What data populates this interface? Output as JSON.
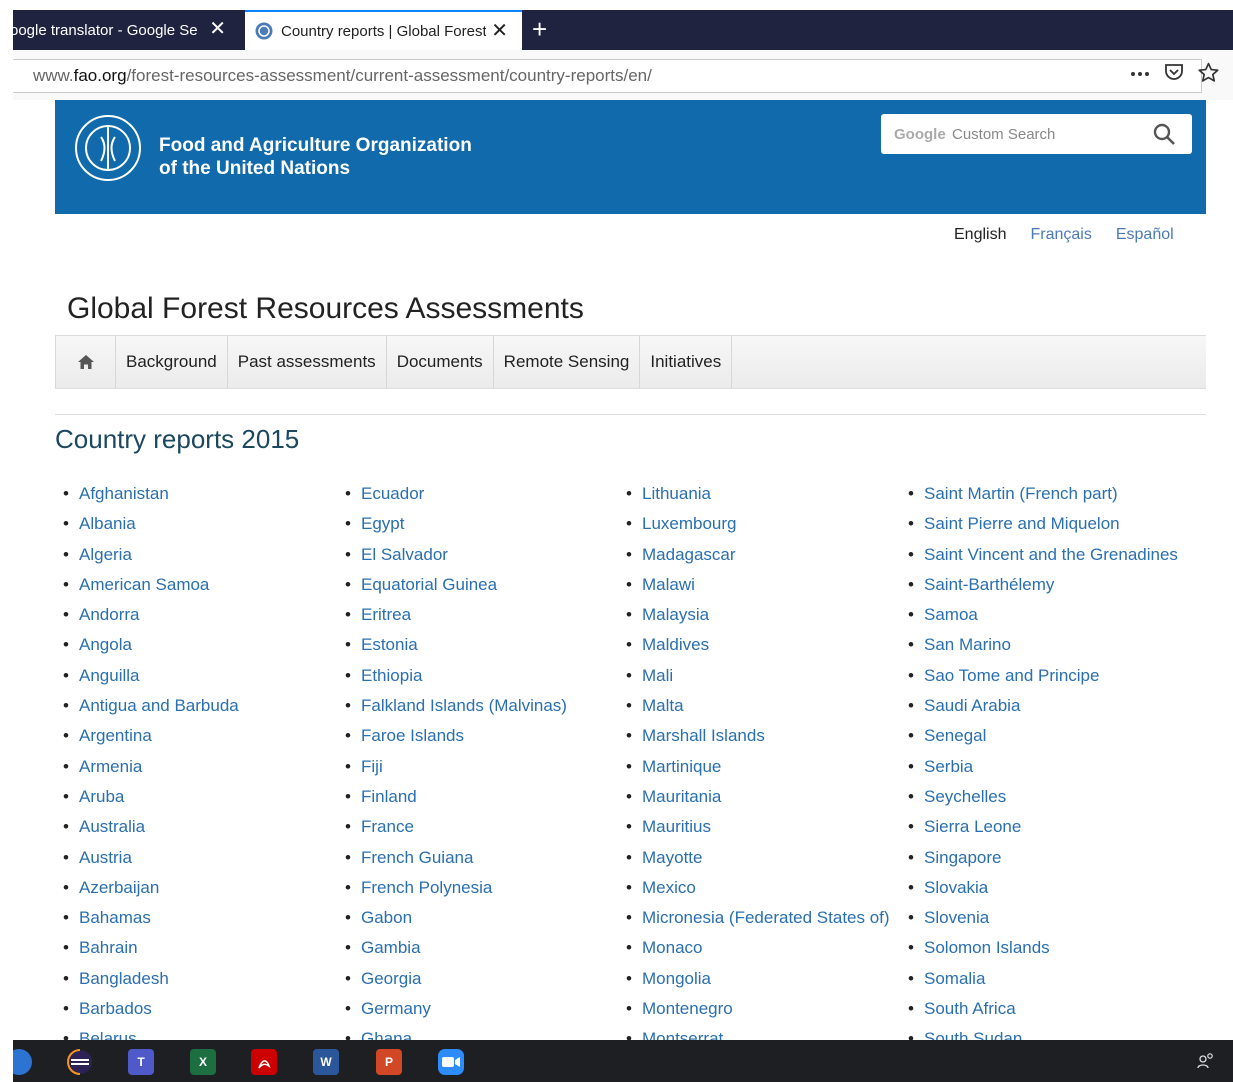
{
  "browser": {
    "tabs": [
      {
        "title": "oogle translator - Google Sea",
        "active": false
      },
      {
        "title": "Country reports | Global Forest",
        "active": true
      }
    ],
    "new_tab_symbol": "+",
    "close_symbol": "✕",
    "url": {
      "prefix": "www.",
      "domain": "fao.org",
      "path": "/forest-resources-assessment/current-assessment/country-reports/en/"
    }
  },
  "header": {
    "org_line1": "Food and Agriculture Organization",
    "org_line2": "of the United Nations",
    "logo_text": "FAO",
    "search": {
      "brand": "Google",
      "placeholder": "Custom Search"
    }
  },
  "languages": {
    "current": "English",
    "others": [
      "Français",
      "Español"
    ]
  },
  "site_title": "Global Forest Resources Assessments",
  "nav": {
    "items": [
      "Background",
      "Past assessments",
      "Documents",
      "Remote Sensing",
      "Initiatives"
    ]
  },
  "section_title": "Country reports 2015",
  "countries": {
    "col1": [
      "Afghanistan",
      "Albania",
      "Algeria",
      "American Samoa",
      "Andorra",
      "Angola",
      "Anguilla",
      "Antigua and Barbuda",
      "Argentina",
      "Armenia",
      "Aruba",
      "Australia",
      "Austria",
      "Azerbaijan",
      "Bahamas",
      "Bahrain",
      "Bangladesh",
      "Barbados",
      "Belarus"
    ],
    "col2": [
      "Ecuador",
      "Egypt",
      "El Salvador",
      "Equatorial Guinea",
      "Eritrea",
      "Estonia",
      "Ethiopia",
      "Falkland Islands (Malvinas)",
      "Faroe Islands",
      "Fiji",
      "Finland",
      "France",
      "French Guiana",
      "French Polynesia",
      "Gabon",
      "Gambia",
      "Georgia",
      "Germany",
      "Ghana"
    ],
    "col3": [
      "Lithuania",
      "Luxembourg",
      "Madagascar",
      "Malawi",
      "Malaysia",
      "Maldives",
      "Mali",
      "Malta",
      "Marshall Islands",
      "Martinique",
      "Mauritania",
      "Mauritius",
      "Mayotte",
      "Mexico",
      "Micronesia (Federated States of)",
      "Monaco",
      "Mongolia",
      "Montenegro",
      "Montserrat"
    ],
    "col4": [
      "Saint Martin (French part)",
      "Saint Pierre and Miquelon",
      "Saint Vincent and the Grenadines",
      "Saint-Barthélemy",
      "Samoa",
      "San Marino",
      "Sao Tome and Principe",
      "Saudi Arabia",
      "Senegal",
      "Serbia",
      "Seychelles",
      "Sierra Leone",
      "Singapore",
      "Slovakia",
      "Slovenia",
      "Solomon Islands",
      "Somalia",
      "South Africa",
      "South Sudan"
    ]
  },
  "colors": {
    "fao_blue": "#116aab",
    "link": "#2a6fb0",
    "tabbar": "#202340",
    "taskbar": "#1e1f22"
  },
  "taskbar": {
    "icons": [
      "edge-icon",
      "eclipse-icon",
      "teams-icon",
      "excel-icon",
      "acrobat-icon",
      "word-icon",
      "powerpoint-icon",
      "zoom-icon"
    ],
    "excel_label": "X",
    "word_label": "W",
    "powerpoint_label": "P"
  }
}
